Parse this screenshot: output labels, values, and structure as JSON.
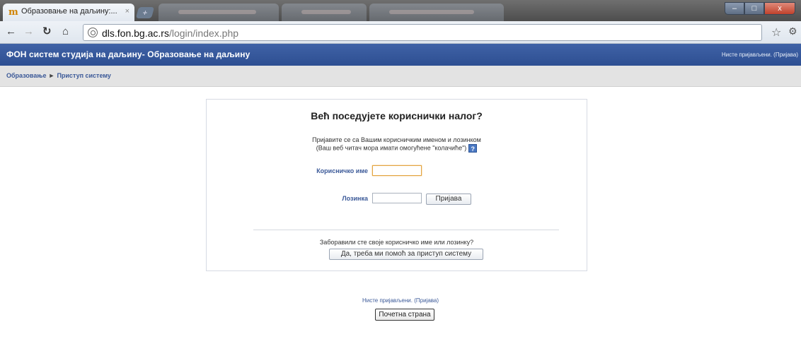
{
  "browser": {
    "active_tab_title": "Образовање на даљину:...",
    "active_tab_close": "×",
    "new_tab_label": "+",
    "url_host": "dls.fon.bg.ac.rs",
    "url_path": "/login/index.php",
    "window_buttons": [
      "–",
      "□",
      "x"
    ]
  },
  "site": {
    "title": "ФОН систем студија на даљину- Образовање на даљину",
    "login_info": "Нисте пријављени. (Пријава)"
  },
  "breadcrumb": {
    "home": "Образовање",
    "separator": "►",
    "current": "Приступ систему"
  },
  "login": {
    "heading": "Већ поседујете кориснички налог?",
    "desc_line1": "Пријавите се са Вашим корисничким именом и лозинком",
    "desc_line2": "(Ваш веб читач мора имати омогућене \"колачиће\")",
    "help_glyph": "?",
    "username_label": "Корисничко име",
    "password_label": "Лозинка",
    "login_button": "Пријава",
    "forgot_text": "Заборавили сте своје корисничко име или лозинку?",
    "forgot_button": "Да, треба ми помоћ за приступ систему"
  },
  "footer": {
    "login_info": "Нисте пријављени. (Пријава)",
    "home_button": "Почетна страна"
  },
  "colors": {
    "header": "#3f62a6",
    "link": "#3b5998",
    "focus_border": "#e3a33e"
  }
}
